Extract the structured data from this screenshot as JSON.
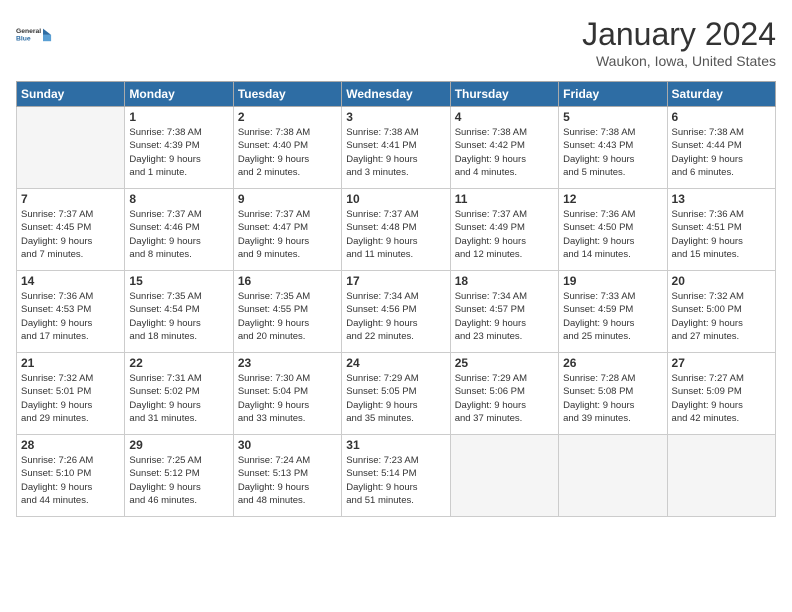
{
  "header": {
    "logo_line1": "General",
    "logo_line2": "Blue",
    "month": "January 2024",
    "location": "Waukon, Iowa, United States"
  },
  "days_of_week": [
    "Sunday",
    "Monday",
    "Tuesday",
    "Wednesday",
    "Thursday",
    "Friday",
    "Saturday"
  ],
  "weeks": [
    [
      {
        "day": "",
        "info": ""
      },
      {
        "day": "1",
        "info": "Sunrise: 7:38 AM\nSunset: 4:39 PM\nDaylight: 9 hours\nand 1 minute."
      },
      {
        "day": "2",
        "info": "Sunrise: 7:38 AM\nSunset: 4:40 PM\nDaylight: 9 hours\nand 2 minutes."
      },
      {
        "day": "3",
        "info": "Sunrise: 7:38 AM\nSunset: 4:41 PM\nDaylight: 9 hours\nand 3 minutes."
      },
      {
        "day": "4",
        "info": "Sunrise: 7:38 AM\nSunset: 4:42 PM\nDaylight: 9 hours\nand 4 minutes."
      },
      {
        "day": "5",
        "info": "Sunrise: 7:38 AM\nSunset: 4:43 PM\nDaylight: 9 hours\nand 5 minutes."
      },
      {
        "day": "6",
        "info": "Sunrise: 7:38 AM\nSunset: 4:44 PM\nDaylight: 9 hours\nand 6 minutes."
      }
    ],
    [
      {
        "day": "7",
        "info": "Sunrise: 7:37 AM\nSunset: 4:45 PM\nDaylight: 9 hours\nand 7 minutes."
      },
      {
        "day": "8",
        "info": "Sunrise: 7:37 AM\nSunset: 4:46 PM\nDaylight: 9 hours\nand 8 minutes."
      },
      {
        "day": "9",
        "info": "Sunrise: 7:37 AM\nSunset: 4:47 PM\nDaylight: 9 hours\nand 9 minutes."
      },
      {
        "day": "10",
        "info": "Sunrise: 7:37 AM\nSunset: 4:48 PM\nDaylight: 9 hours\nand 11 minutes."
      },
      {
        "day": "11",
        "info": "Sunrise: 7:37 AM\nSunset: 4:49 PM\nDaylight: 9 hours\nand 12 minutes."
      },
      {
        "day": "12",
        "info": "Sunrise: 7:36 AM\nSunset: 4:50 PM\nDaylight: 9 hours\nand 14 minutes."
      },
      {
        "day": "13",
        "info": "Sunrise: 7:36 AM\nSunset: 4:51 PM\nDaylight: 9 hours\nand 15 minutes."
      }
    ],
    [
      {
        "day": "14",
        "info": "Sunrise: 7:36 AM\nSunset: 4:53 PM\nDaylight: 9 hours\nand 17 minutes."
      },
      {
        "day": "15",
        "info": "Sunrise: 7:35 AM\nSunset: 4:54 PM\nDaylight: 9 hours\nand 18 minutes."
      },
      {
        "day": "16",
        "info": "Sunrise: 7:35 AM\nSunset: 4:55 PM\nDaylight: 9 hours\nand 20 minutes."
      },
      {
        "day": "17",
        "info": "Sunrise: 7:34 AM\nSunset: 4:56 PM\nDaylight: 9 hours\nand 22 minutes."
      },
      {
        "day": "18",
        "info": "Sunrise: 7:34 AM\nSunset: 4:57 PM\nDaylight: 9 hours\nand 23 minutes."
      },
      {
        "day": "19",
        "info": "Sunrise: 7:33 AM\nSunset: 4:59 PM\nDaylight: 9 hours\nand 25 minutes."
      },
      {
        "day": "20",
        "info": "Sunrise: 7:32 AM\nSunset: 5:00 PM\nDaylight: 9 hours\nand 27 minutes."
      }
    ],
    [
      {
        "day": "21",
        "info": "Sunrise: 7:32 AM\nSunset: 5:01 PM\nDaylight: 9 hours\nand 29 minutes."
      },
      {
        "day": "22",
        "info": "Sunrise: 7:31 AM\nSunset: 5:02 PM\nDaylight: 9 hours\nand 31 minutes."
      },
      {
        "day": "23",
        "info": "Sunrise: 7:30 AM\nSunset: 5:04 PM\nDaylight: 9 hours\nand 33 minutes."
      },
      {
        "day": "24",
        "info": "Sunrise: 7:29 AM\nSunset: 5:05 PM\nDaylight: 9 hours\nand 35 minutes."
      },
      {
        "day": "25",
        "info": "Sunrise: 7:29 AM\nSunset: 5:06 PM\nDaylight: 9 hours\nand 37 minutes."
      },
      {
        "day": "26",
        "info": "Sunrise: 7:28 AM\nSunset: 5:08 PM\nDaylight: 9 hours\nand 39 minutes."
      },
      {
        "day": "27",
        "info": "Sunrise: 7:27 AM\nSunset: 5:09 PM\nDaylight: 9 hours\nand 42 minutes."
      }
    ],
    [
      {
        "day": "28",
        "info": "Sunrise: 7:26 AM\nSunset: 5:10 PM\nDaylight: 9 hours\nand 44 minutes."
      },
      {
        "day": "29",
        "info": "Sunrise: 7:25 AM\nSunset: 5:12 PM\nDaylight: 9 hours\nand 46 minutes."
      },
      {
        "day": "30",
        "info": "Sunrise: 7:24 AM\nSunset: 5:13 PM\nDaylight: 9 hours\nand 48 minutes."
      },
      {
        "day": "31",
        "info": "Sunrise: 7:23 AM\nSunset: 5:14 PM\nDaylight: 9 hours\nand 51 minutes."
      },
      {
        "day": "",
        "info": ""
      },
      {
        "day": "",
        "info": ""
      },
      {
        "day": "",
        "info": ""
      }
    ]
  ]
}
